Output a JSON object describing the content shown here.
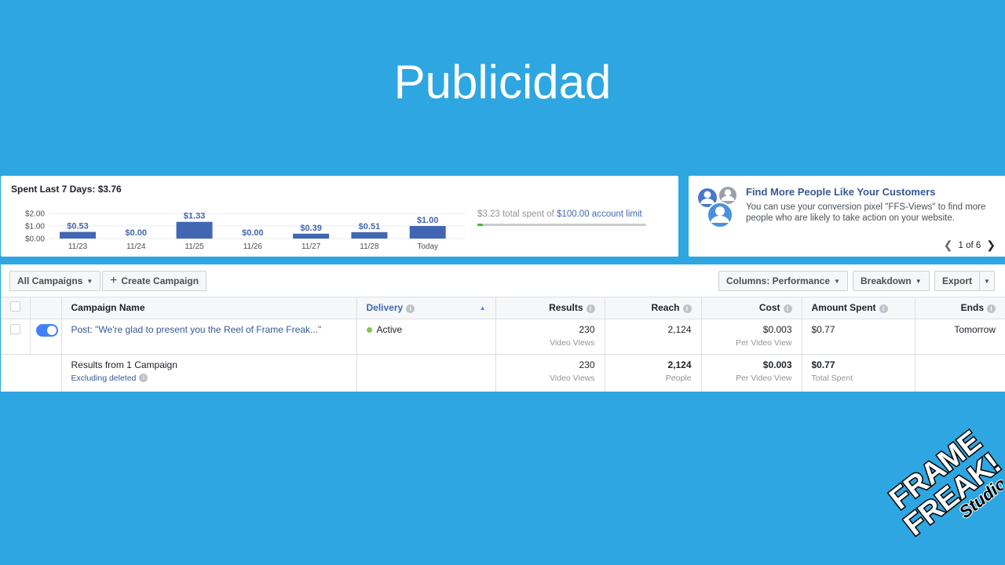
{
  "slide": {
    "title": "Publicidad"
  },
  "spent": {
    "title": "Spent Last 7 Days: $3.76",
    "y_ticks": [
      "$2.00",
      "$1.00",
      "$0.00"
    ],
    "limit_prefix": "$3.23 total spent of",
    "limit_link": "$100.00 account limit",
    "limit_fraction": 0.0323
  },
  "chart_data": {
    "type": "bar",
    "title": "Spent Last 7 Days: $3.76",
    "categories": [
      "11/23",
      "11/24",
      "11/25",
      "11/26",
      "11/27",
      "11/28",
      "Today"
    ],
    "values": [
      0.53,
      0.0,
      1.33,
      0.0,
      0.39,
      0.51,
      1.0
    ],
    "value_labels": [
      "$0.53",
      "$0.00",
      "$1.33",
      "$0.00",
      "$0.39",
      "$0.51",
      "$1.00"
    ],
    "y_ticks": [
      "$2.00",
      "$1.00",
      "$0.00"
    ],
    "ylim": [
      0,
      2
    ],
    "bar_color": "#4267b2"
  },
  "promo": {
    "title": "Find More People Like Your Customers",
    "description": "You can use your conversion pixel \"FFS-Views\" to find more people who are likely to take action on your website.",
    "pager": "1 of 6"
  },
  "toolbar": {
    "all_campaigns": "All Campaigns",
    "create_campaign": "Create Campaign",
    "columns": "Columns: Performance",
    "breakdown": "Breakdown",
    "export": "Export"
  },
  "table": {
    "headers": {
      "name": "Campaign Name",
      "delivery": "Delivery",
      "results": "Results",
      "reach": "Reach",
      "cost": "Cost",
      "amount": "Amount Spent",
      "ends": "Ends"
    },
    "row": {
      "name": "Post: \"We're glad to present you the Reel of Frame Freak...\"",
      "delivery": "Active",
      "results": "230",
      "results_sub": "Video Views",
      "reach": "2,124",
      "cost": "$0.003",
      "cost_sub": "Per Video View",
      "amount": "$0.77",
      "ends": "Tomorrow"
    },
    "total": {
      "name": "Results from 1 Campaign",
      "name_sub": "Excluding deleted",
      "results": "230",
      "results_sub": "Video Views",
      "reach": "2,124",
      "reach_sub": "People",
      "cost": "$0.003",
      "cost_sub": "Per Video View",
      "amount": "$0.77",
      "amount_sub": "Total Spent"
    }
  },
  "logo": {
    "line1": "FRAME",
    "line2": "FREAK!",
    "line3": "Studio"
  },
  "colors": {
    "background": "#2ea6e1",
    "accent": "#4267b2",
    "active": "#8bc34a"
  }
}
